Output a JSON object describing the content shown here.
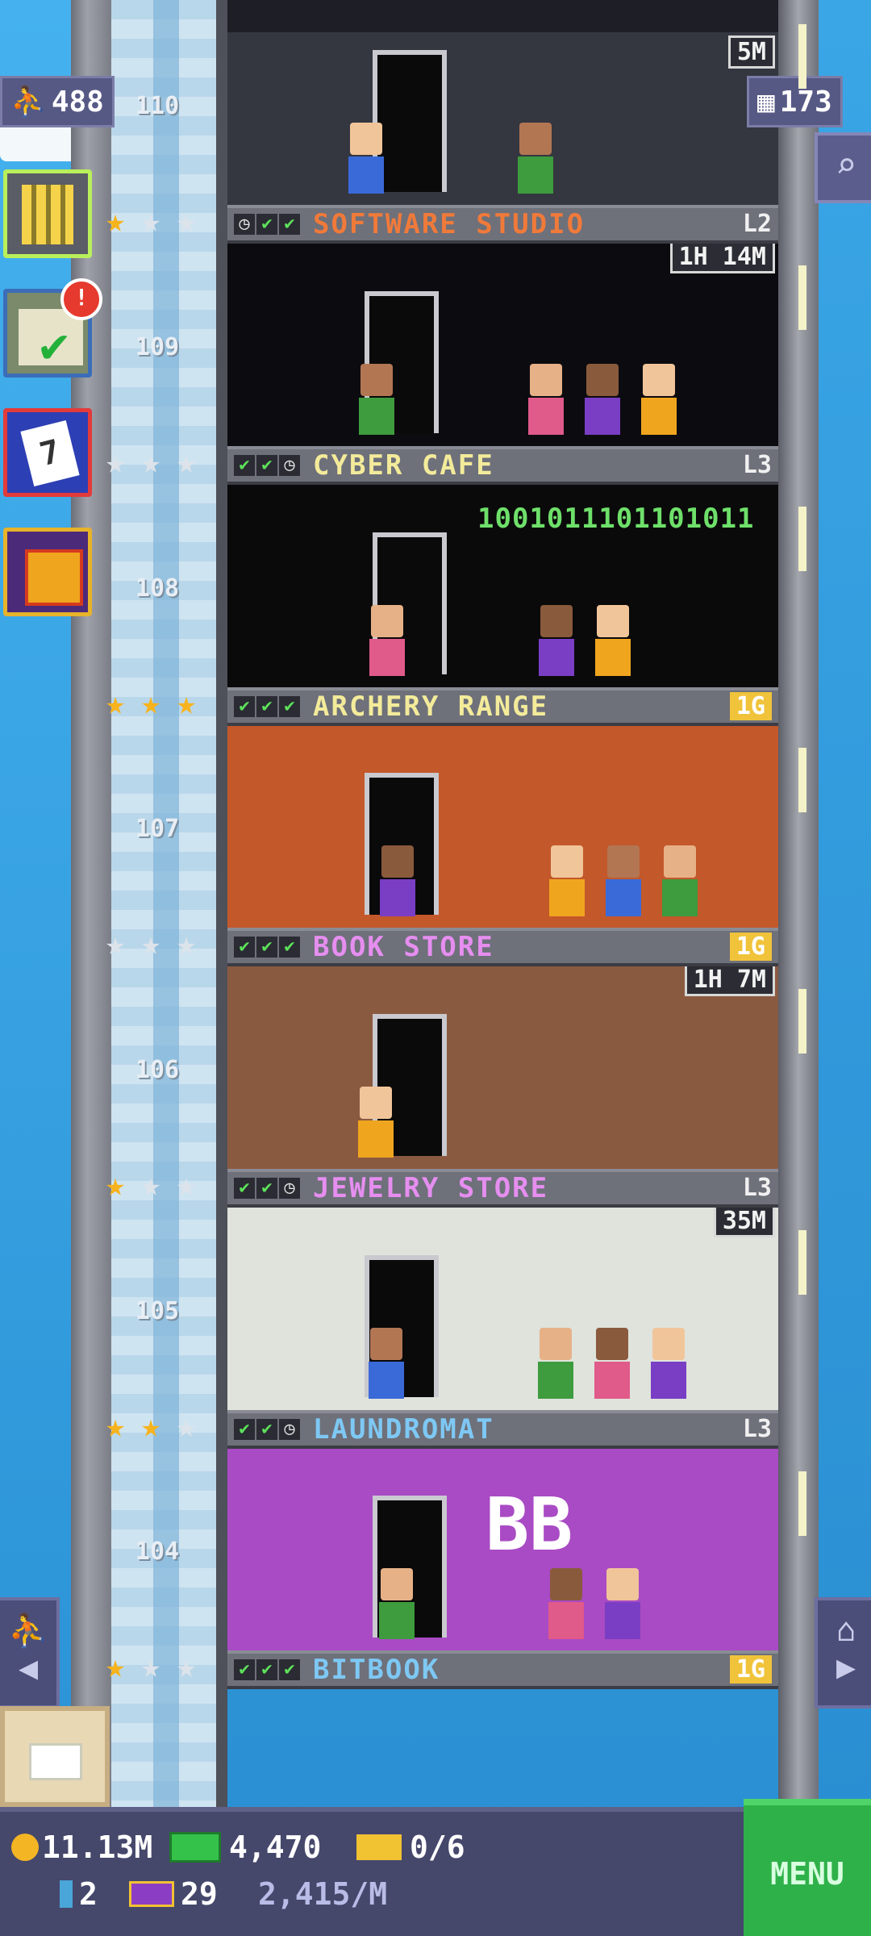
{
  "tower": {
    "population": "488",
    "floor_count": "173"
  },
  "floors": [
    {
      "number": "110",
      "name": "SOFTWARE STUDIO",
      "level": "L2",
      "timer": "5M",
      "name_color": "#f07a3a",
      "checks": [
        "clock",
        "check",
        "check"
      ],
      "stars": [
        "gold",
        "silver",
        "silver"
      ],
      "level_style": "plain"
    },
    {
      "number": "109",
      "name": "CYBER CAFE",
      "level": "L3",
      "timer": "1H 14M",
      "name_color": "#f3eb9a",
      "checks": [
        "check",
        "check",
        "clock"
      ],
      "stars": [
        "silver",
        "silver",
        "silver"
      ],
      "level_style": "plain"
    },
    {
      "number": "108",
      "name": "ARCHERY RANGE",
      "level": "1G",
      "timer": "",
      "name_color": "#f3eb9a",
      "checks": [
        "check",
        "check",
        "check"
      ],
      "stars": [
        "gold",
        "gold",
        "gold"
      ],
      "level_style": "gold"
    },
    {
      "number": "107",
      "name": "BOOK STORE",
      "level": "1G",
      "timer": "",
      "name_color": "#e68ef0",
      "checks": [
        "check",
        "check",
        "check"
      ],
      "stars": [
        "silver",
        "silver",
        "silver"
      ],
      "level_style": "gold"
    },
    {
      "number": "106",
      "name": "JEWELRY STORE",
      "level": "L3",
      "timer": "1H 7M",
      "name_color": "#e68ef0",
      "checks": [
        "check",
        "check",
        "clock"
      ],
      "stars": [
        "gold",
        "silver",
        "silver"
      ],
      "level_style": "plain"
    },
    {
      "number": "105",
      "name": "LAUNDROMAT",
      "level": "L3",
      "timer": "35M",
      "name_color": "#7ec8f4",
      "checks": [
        "check",
        "check",
        "clock"
      ],
      "stars": [
        "gold",
        "gold",
        "silver"
      ],
      "level_style": "plain"
    },
    {
      "number": "104",
      "name": "BITBOOK",
      "level": "1G",
      "timer": "",
      "name_color": "#7ec8f4",
      "checks": [
        "check",
        "check",
        "check"
      ],
      "stars": [
        "gold",
        "silver",
        "silver"
      ],
      "level_style": "gold"
    }
  ],
  "floor_scenes": {
    "archery_code": "1001011101101011",
    "bitbook_sign": "BB"
  },
  "side_buttons": {
    "missions_badge": "!",
    "calendar_day": "7"
  },
  "hud": {
    "coins": "11.13M",
    "bux": "4,470",
    "vip": "0/6",
    "tickets": "2",
    "golden": "29",
    "rate": "2,415/M",
    "menu_label": "MENU"
  },
  "colors": {
    "sky": "#2f9ad8",
    "hud_bg": "#45476b",
    "menu_green": "#2fb14a",
    "check_green": "#5de25a"
  }
}
